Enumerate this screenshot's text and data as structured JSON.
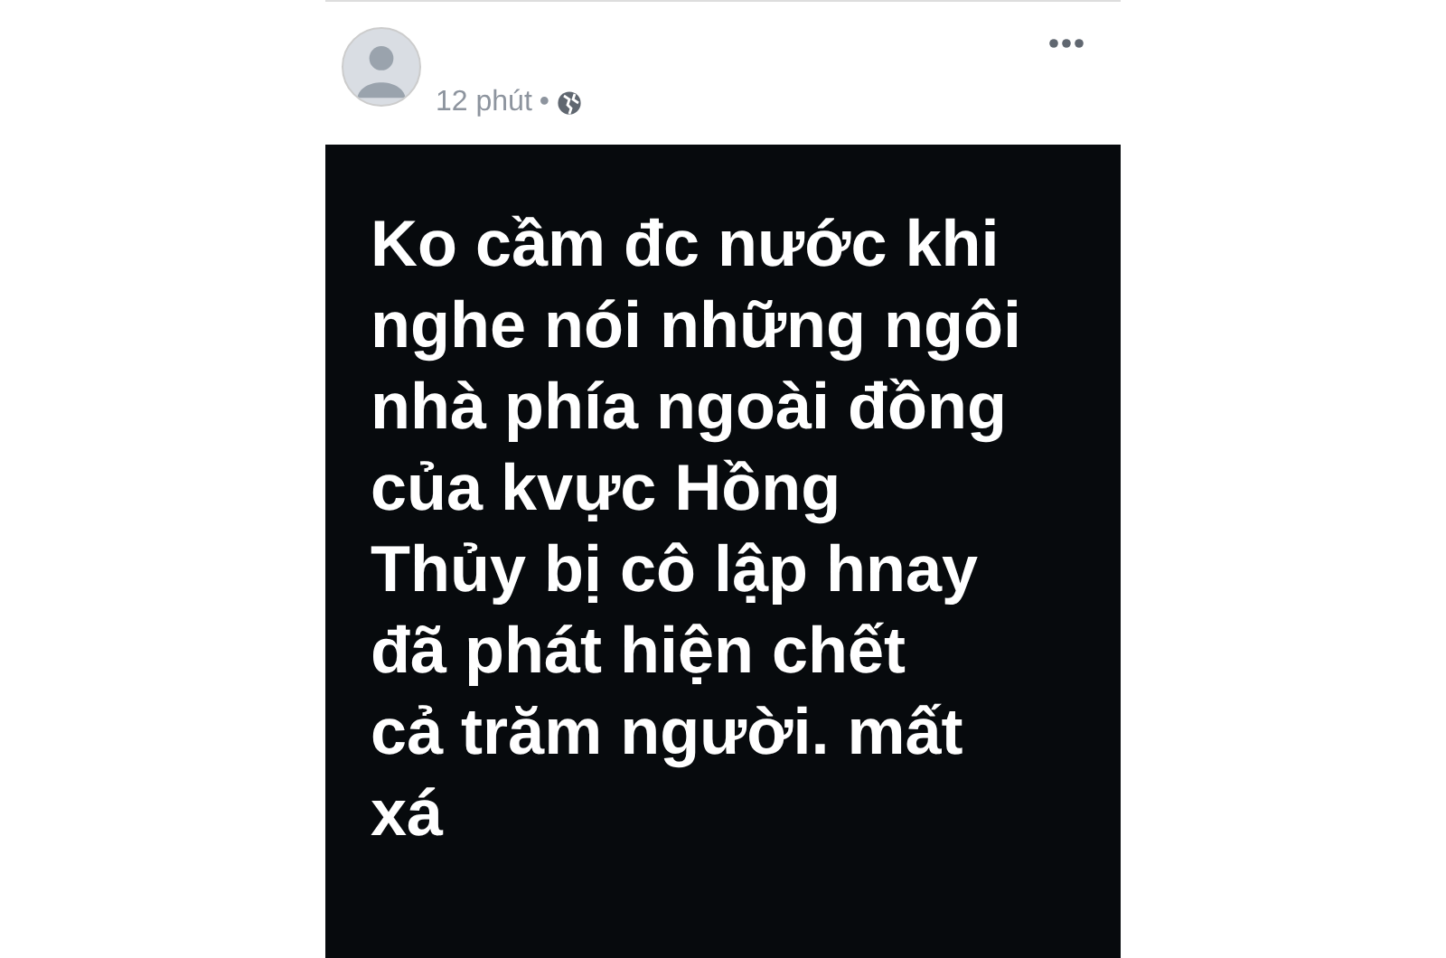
{
  "post": {
    "time": "12 phút",
    "separator": "•",
    "text_lines": [
      "Ko cầm đc nước khi",
      "nghe nói những ngôi",
      "nhà phía ngoài đồng",
      "của kvực Hồng",
      "Thủy bị cô lập hnay",
      "đã phát hiện chết",
      "cả trăm người. mất",
      "xá"
    ]
  }
}
